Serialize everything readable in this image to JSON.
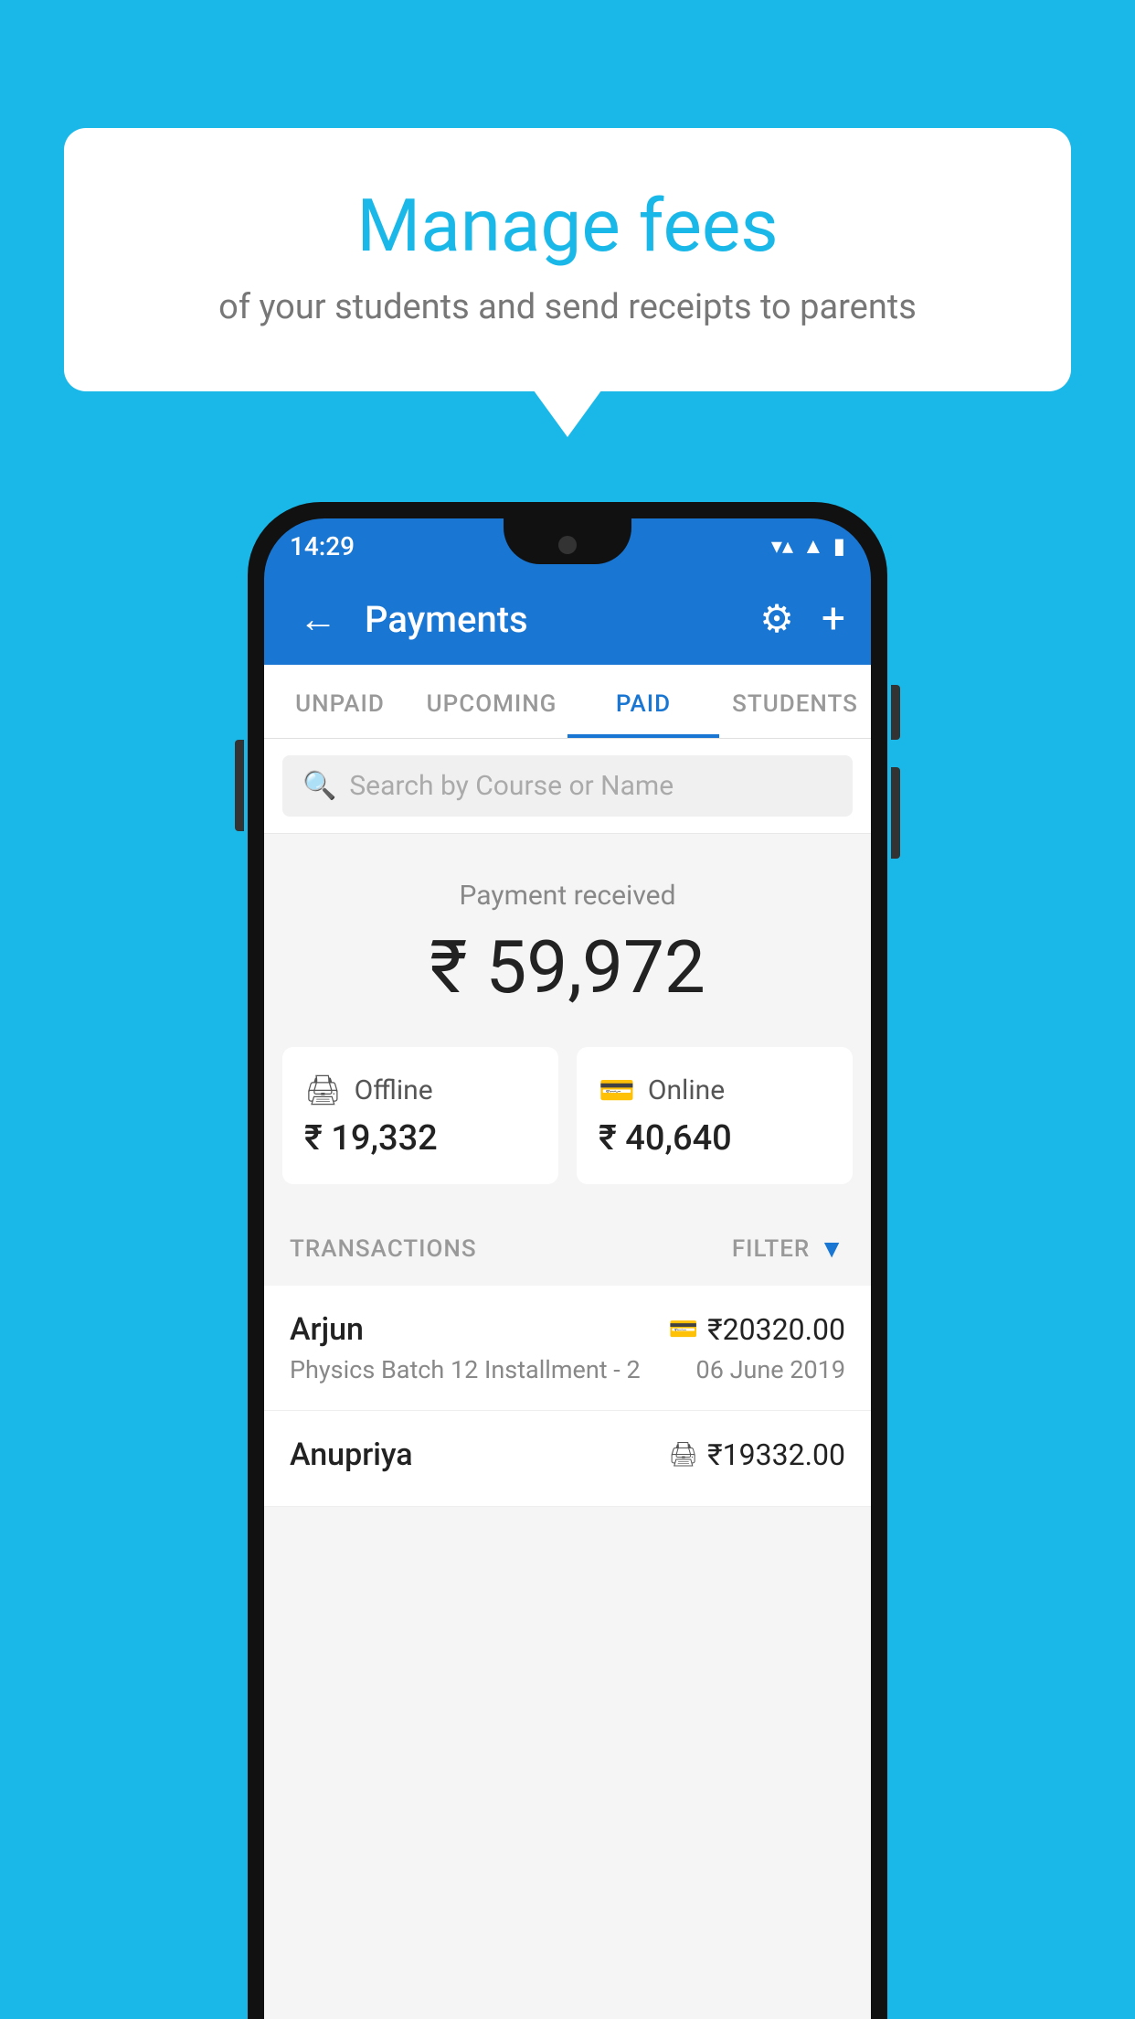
{
  "background_color": "#1ab8e8",
  "bubble": {
    "title": "Manage fees",
    "subtitle": "of your students and send receipts to parents"
  },
  "status_bar": {
    "time": "14:29",
    "wifi": "▼",
    "signal": "▲",
    "battery": "▮"
  },
  "app_bar": {
    "title": "Payments",
    "back_label": "←",
    "gear_label": "⚙",
    "plus_label": "+"
  },
  "tabs": [
    {
      "label": "UNPAID",
      "active": false
    },
    {
      "label": "UPCOMING",
      "active": false
    },
    {
      "label": "PAID",
      "active": true
    },
    {
      "label": "STUDENTS",
      "active": false
    }
  ],
  "search": {
    "placeholder": "Search by Course or Name"
  },
  "payment_summary": {
    "label": "Payment received",
    "amount": "₹ 59,972"
  },
  "payment_cards": [
    {
      "type": "Offline",
      "icon": "💳",
      "amount": "₹ 19,332"
    },
    {
      "type": "Online",
      "icon": "💳",
      "amount": "₹ 40,640"
    }
  ],
  "transactions_section": {
    "label": "TRANSACTIONS",
    "filter_label": "FILTER"
  },
  "transactions": [
    {
      "name": "Arjun",
      "course": "Physics Batch 12 Installment - 2",
      "amount": "₹20320.00",
      "date": "06 June 2019",
      "payment_type": "online"
    },
    {
      "name": "Anupriya",
      "course": "",
      "amount": "₹19332.00",
      "date": "",
      "payment_type": "offline"
    }
  ]
}
